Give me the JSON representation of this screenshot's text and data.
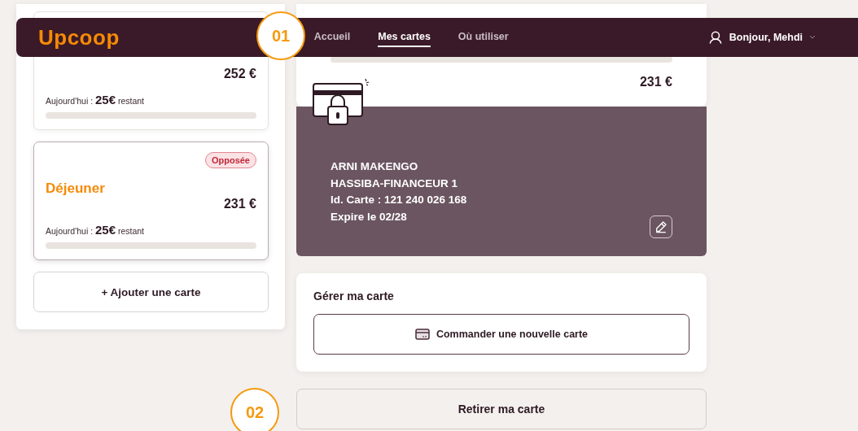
{
  "navbar": {
    "logo": "Upcoop",
    "links": [
      {
        "label": "Accueil",
        "selected": false
      },
      {
        "label": "Mes cartes",
        "selected": true
      },
      {
        "label": "Où utiliser",
        "selected": false
      }
    ],
    "user": "Bonjour, Mehdi"
  },
  "annotations": [
    "01",
    "02"
  ],
  "card_list": {
    "cards": [
      {
        "amount": "252 €",
        "today_label": "Aujourd'hui :",
        "today_amount": "25€",
        "today_suffix": "restant",
        "level": 0,
        "selected": false
      },
      {
        "name": "Déjeuner",
        "status": "Opposée",
        "amount": "231 €",
        "today_label": "Aujourd'hui :",
        "today_amount": "25€",
        "today_suffix": "restant",
        "level": 0,
        "selected": true
      }
    ],
    "add_button": "+ Ajouter une carte"
  },
  "detail": {
    "header": {
      "level": 0,
      "amount": "231 €"
    },
    "card_info": {
      "locked": true,
      "lines": [
        "ARNI MAKENGO",
        "HASSIBA-FINANCEUR 1",
        "Id. Carte : 121 240 026 168",
        "Expire le 02/28"
      ]
    },
    "manage": {
      "title": "Gérer ma carte",
      "order_button": "Commander une nouvelle carte"
    },
    "remove_button": "Retirer ma carte"
  }
}
